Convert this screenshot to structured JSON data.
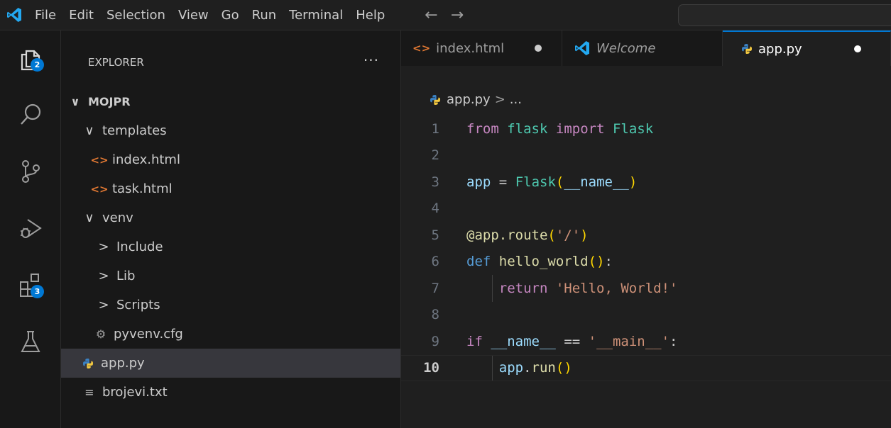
{
  "menu": [
    "File",
    "Edit",
    "Selection",
    "View",
    "Go",
    "Run",
    "Terminal",
    "Help"
  ],
  "nav": {
    "back": "←",
    "forward": "→"
  },
  "activity": {
    "explorer_badge": "2",
    "extensions_badge": "3"
  },
  "explorer": {
    "title": "EXPLORER",
    "more": "···",
    "root": "MOJPR",
    "items": [
      {
        "label": "templates",
        "chev": "∨"
      },
      {
        "label": "index.html",
        "icon": "<>"
      },
      {
        "label": "task.html",
        "icon": "<>"
      },
      {
        "label": "venv",
        "chev": "∨"
      },
      {
        "label": "Include",
        "chev": ">"
      },
      {
        "label": "Lib",
        "chev": ">"
      },
      {
        "label": "Scripts",
        "chev": ">"
      },
      {
        "label": "pyvenv.cfg"
      },
      {
        "label": "app.py"
      },
      {
        "label": "brojevi.txt"
      }
    ]
  },
  "tabs": [
    {
      "label": "index.html",
      "icon": "<>"
    },
    {
      "label": "Welcome"
    },
    {
      "label": "app.py"
    }
  ],
  "breadcrumb": {
    "file": "app.py",
    "sep": ">",
    "rest": "..."
  },
  "code": {
    "line_numbers": [
      "1",
      "2",
      "3",
      "4",
      "5",
      "6",
      "7",
      "8",
      "9",
      "10"
    ],
    "l1": {
      "a": "from",
      "b": "flask",
      "c": "import",
      "d": "Flask"
    },
    "l3": {
      "a": "app",
      "b": "=",
      "c": "Flask",
      "d": "(",
      "e": "__name__",
      "f": ")"
    },
    "l5": {
      "a": "@app.route",
      "b": "(",
      "c": "'/'",
      "d": ")"
    },
    "l6": {
      "a": "def",
      "b": "hello_world",
      "c": "()",
      "d": ":"
    },
    "l7": {
      "a": "return",
      "b": "'Hello, World!'"
    },
    "l9": {
      "a": "if",
      "b": "__name__",
      "c": "==",
      "d": "'__main__'",
      "e": ":"
    },
    "l10": {
      "a": "app",
      "b": ".",
      "c": "run",
      "d": "()"
    }
  },
  "colors": {
    "accent": "#0078d4",
    "keyword": "#c586c0",
    "class": "#4ec9b0",
    "function": "#dcdcaa",
    "string": "#ce9178"
  }
}
